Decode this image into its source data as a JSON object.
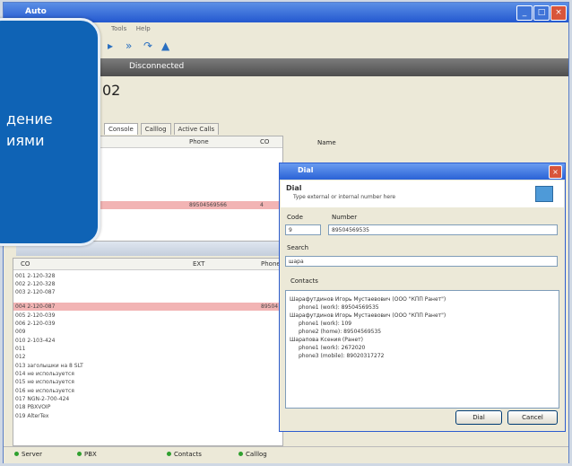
{
  "window": {
    "title": "Auto",
    "menu": [
      "Tools",
      "Help"
    ],
    "status": "Disconnected",
    "account": "02"
  },
  "tabs": [
    "Console",
    "Calllog",
    "Active Calls"
  ],
  "top_table": {
    "headers": [
      "Phone",
      "CO",
      "Name"
    ],
    "highlight_phone": "89504569566",
    "highlight_co": "4"
  },
  "co_table": {
    "headers": [
      "CO",
      "EXT",
      "Phone"
    ],
    "rows": [
      "001 2-120-328",
      "002 2-120-328",
      "003 2-120-087",
      "004 2-120-087",
      "005 2-120-039",
      "006 2-120-039",
      "009",
      "010 2-103-424",
      "011",
      "012",
      "013 заголышки на 8 SLT",
      "014 не используется",
      "015 не используется",
      "016 не используется",
      "017 NGN-2-700-424",
      "018 PBXVOIP",
      "019 AlterTex"
    ],
    "highlight_phone": "89504"
  },
  "dialog": {
    "title": "Dial",
    "heading": "Dial",
    "subtitle": "Type external or internal number here",
    "code_label": "Code",
    "code_value": "9",
    "number_label": "Number",
    "number_value": "89504569535",
    "search_label": "Search",
    "search_value": "шара",
    "contacts_label": "Contacts",
    "contacts": [
      "Шарафутдинов Игорь Мустаевович (ООО \"КПП Ранет\")",
      "phone1 (work): 89504569535",
      "Шарафутдинов Игорь Мустаевович (ООО \"КПП Ранет\")",
      "phone1 (work): 109",
      "phone2 (home): 89504569535",
      "Шарапова Ксения (Ранет)",
      "phone1 (work): 2672020",
      "phone3 (mobile): 89020317272"
    ],
    "dial_button": "Dial",
    "cancel_button": "Cancel"
  },
  "statusbar": [
    "Server",
    "PBX",
    "Contacts",
    "Calllog"
  ],
  "overlay": {
    "line1": "дение",
    "line2": "иями"
  },
  "colors": {
    "accent": "#0f63b5",
    "highlight": "#f2b4b4",
    "title_bar": "#2358cf"
  }
}
